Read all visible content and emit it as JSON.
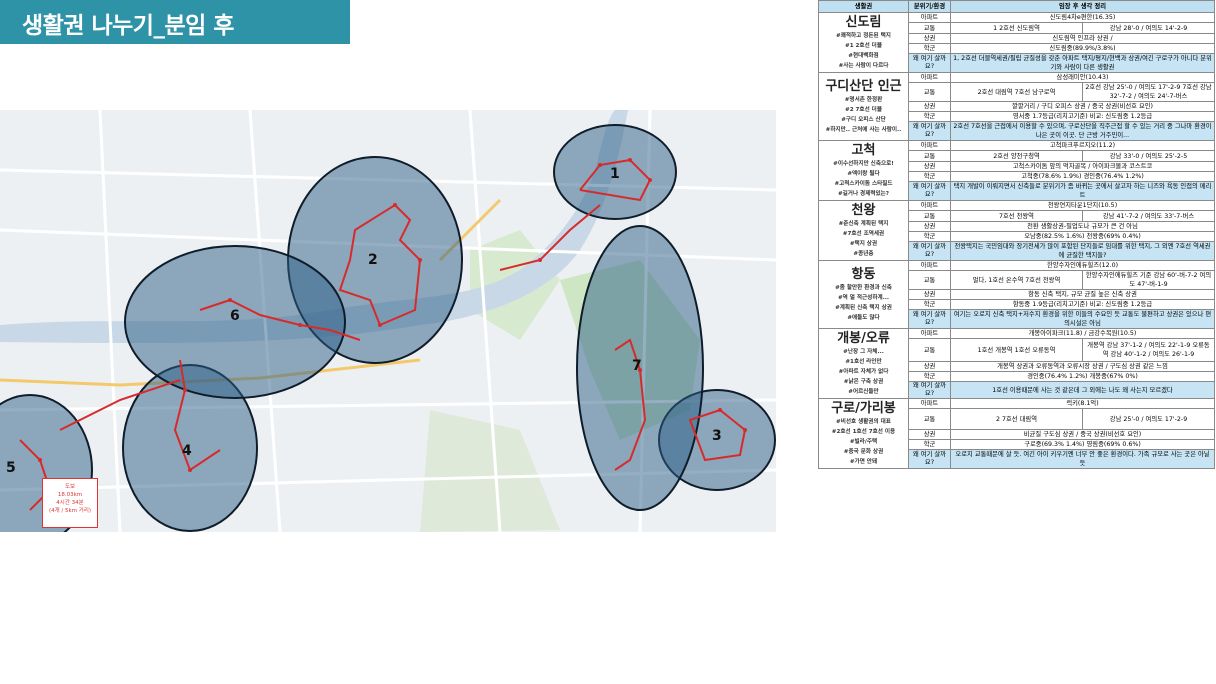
{
  "title": "생활권 나누기_분임 후",
  "map": {
    "zones": [
      "1",
      "2",
      "3",
      "4",
      "5",
      "6",
      "7"
    ],
    "legend": {
      "l1": "도보",
      "l2": "18.03km",
      "l3": "4시간 34분",
      "l4": "(4개 / 5km 거리)"
    },
    "route_color": "#d62b2b",
    "zone_fill": "#2c5d85"
  },
  "table": {
    "headers": {
      "area": "생활권",
      "cat": "분위기/환경",
      "summary": "임장 후 생각 정리"
    },
    "why_label": "왜 여기 살까요?",
    "cats": {
      "apt": "아파트",
      "traffic": "교통",
      "shop": "상권",
      "school": "학군"
    },
    "sections": [
      {
        "name": "신도림",
        "tags": [
          "#쾌적하고 정돈된 택지",
          "#1 2호선 더블",
          "#현대백화점",
          "#사는 사람이 다르다"
        ],
        "apt": "신도림4차e편한(16.35)",
        "traffic_a": "1 2호선 신도림역",
        "traffic_b": "강남 28'-0 / 여의도 14'-2-9",
        "shop": "신도림역 인프라 상권 /",
        "school": "신도림중(89.9%/3.8%)",
        "why": "1, 2호선 더블역세권/필립 균질성을 갖춘 아파트 택지/평지/현백과 상권/여긴 구로구가 아니다 분위기와 사람이 다른 생활권"
      },
      {
        "name": "구디산단 인근",
        "tags": [
          "#명서촌 한정판",
          "#2 7호선 더블",
          "#구디 오피스 산단",
          "#하지만.. 근처에 사는 사람이.."
        ],
        "apt": "삼성래미안(10.43)",
        "traffic_a": "2호선 대림역 7호선 남구로역",
        "traffic_b": "2호선 강남 25'-0 / 여의도 17'-2-9 7호선 강남 32'-7-2 / 여의도 24'-7-버스",
        "shop": "깔깔거리 / 구디 오피스 상권 / 중국 상권(비선호 요인)",
        "school": "영서중 1.7등급(리치고기준) 비교: 신도림중 1.2등급",
        "why": "2호선 7호선을 근접에서 이용할 수 있으며, 구로산단을 직주근접 할 수 있는 거리 중 그나마 환경이 나은 곳이 이곳. 단 근방 거주민이..."
      },
      {
        "name": "고척",
        "tags": [
          "#이수선하지만 신축으로!",
          "#엑이랑 될다",
          "#고척스카이돔 스타필드",
          "#길거나 경제력있는?"
        ],
        "apt": "고척파크푸르지오(11.2)",
        "traffic_a": "2호선 양천구청역",
        "traffic_b": "강남 33'-0 / 여의도 25'-2-5",
        "shop": "고척스카이돔 앞의 먹자골목 / 아이파크몰과 코스트코",
        "school": "고척중(78.6% 1.9%) 경인중(76.4% 1.2%)",
        "why": "택지 개발이 이뤄지면서 신축들로 분위기가 좀 바뀌는 곳에서 살고자 하는 니즈와 욕동 인접의 메리트"
      },
      {
        "name": "천왕",
        "tags": [
          "#준신축 계획된 택지",
          "#7호선 조역세권",
          "#택지 상권",
          "#종년층"
        ],
        "apt": "천왕연지타운1단지(10.5)",
        "traffic_a": "7호선 천왕역",
        "traffic_b": "강남 41'-7-2 / 여의도 33'-7-버스",
        "shop": "천환 생활상권-필업도나 규모가 큰 건 아님",
        "school": "오남중(82.5% 1.6%) 천왕중(69% 0.4%)",
        "why": "천왕택지는 국민임대와 장기전세가 많이 포함된 단지들로 임대를 위한 택지, 그 외엔 7호선 역세권에 균질한 택지들?"
      },
      {
        "name": "항동",
        "tags": [
          "#좀 할만한 환경과 신축",
          "#역 멀 적근성하계...",
          "#계획된 신축 택지 상권",
          "#애들도 많다"
        ],
        "apt": "한양수자인에듀힐즈(12.0)",
        "traffic_a": "멀다, 1호선 온수역 7호선 천왕역",
        "traffic_b": "한양수자인에듀힐즈 기준 강남 60'-버-7-2 여의도 47'-버-1-9",
        "shop": "항동 신축 택지, 규모 균질 높은 신축 상권",
        "school": "항동중 1.9등급(리치고기준) 비교: 신도림중 1.2등급",
        "why": "여기는 오로지 신축 택지+저수지 환경을 위한 이들의 수요인 듯 교통도 불편하고 상권은 있으나 편의시설은 아님"
      },
      {
        "name": "개봉/오류",
        "tags": [
          "#난장 그 자체...",
          "#1호선 라인만",
          "#아파트 자체가 없다",
          "#낡은 구축 상권",
          "#어르신들만"
        ],
        "apt": "개봉아이파크(11.8) / 금강수목원(10.5)",
        "traffic_a": "1호선 개봉역 1호선 오류동역",
        "traffic_b": "개봉역 강남 37'-1-2 / 여의도 22'-1-9 오류동역 강남 40'-1-2 / 여의도 26'-1-9",
        "shop": "개봉역 상권과 오류동역과 오류시장 상권 / 구도심 상권 같은 느낌",
        "school": "경인중(76.4% 1.2%) 개봉중(67% 0%)",
        "why": "1호선 이용때문에 사는 것 같은데 그 외에는 나도 왜 사는지 모르겠다"
      },
      {
        "name": "구로/가리봉",
        "tags": [
          "#비선호 생활권의 대표",
          "#2호선 1호선 7호선 이용",
          "#빌라/주택",
          "#중국 문화 상권",
          "#가면 안돼"
        ],
        "apt": "럭키(8.1억)",
        "traffic_a": "2 7호선 대림역",
        "traffic_b": "강남 25'-0 / 여의도 17'-2-9",
        "shop": "비균질 구도심 상권 / 중국 상권(비선호 요인)",
        "school": "구로중(69.3% 1.4%) 영림중(69% 0.6%)",
        "why": "오로지 교통때문에 살 듯. 여긴 아이 키우기엔 너무 안 좋은 환경이다. 가족 규모로 사는 곳은 아닐 듯"
      }
    ]
  }
}
